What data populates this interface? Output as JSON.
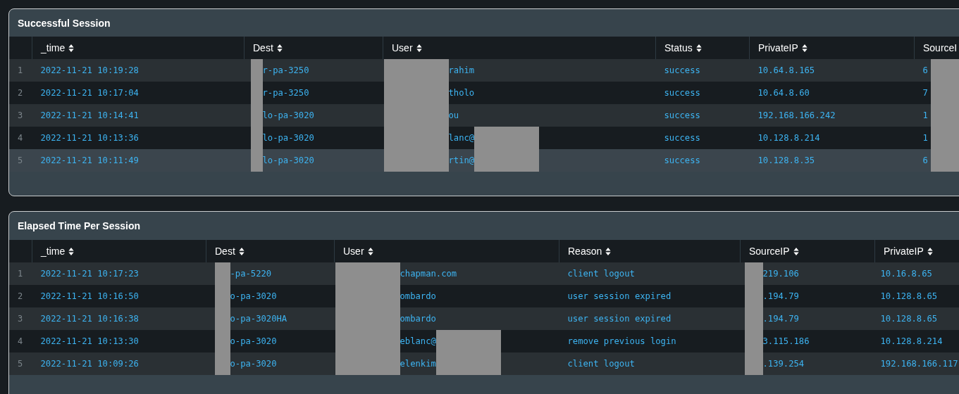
{
  "panels": [
    {
      "title": "Successful Session",
      "columns": [
        {
          "label": "_time"
        },
        {
          "label": "Dest"
        },
        {
          "label": "User"
        },
        {
          "label": "Status"
        },
        {
          "label": "PrivateIP"
        },
        {
          "label": "SourceI"
        }
      ],
      "rows": [
        {
          "number": "1",
          "hovered": false,
          "cells": [
            {
              "text": "2022-11-21 10:19:28"
            },
            {
              "text": "r-pa-3250",
              "redacted_start": true
            },
            {
              "text": "rahim",
              "redacted_start": true
            },
            {
              "text": "success"
            },
            {
              "text": "10.64.8.165"
            },
            {
              "text": "6",
              "redacted_end": true
            }
          ]
        },
        {
          "number": "2",
          "hovered": false,
          "cells": [
            {
              "text": "2022-11-21 10:17:04"
            },
            {
              "text": "r-pa-3250",
              "redacted_start": true
            },
            {
              "text": "tholo",
              "redacted_start": true
            },
            {
              "text": "success"
            },
            {
              "text": "10.64.8.60"
            },
            {
              "text": "7",
              "redacted_end": true
            }
          ]
        },
        {
          "number": "3",
          "hovered": false,
          "cells": [
            {
              "text": "2022-11-21 10:14:41"
            },
            {
              "text": "lo-pa-3020",
              "redacted_start": true
            },
            {
              "text": "ou",
              "redacted_start": true
            },
            {
              "text": "success"
            },
            {
              "text": "192.168.166.242"
            },
            {
              "text": "1",
              "redacted_end": true
            }
          ]
        },
        {
          "number": "4",
          "hovered": false,
          "cells": [
            {
              "text": "2022-11-21 10:13:36"
            },
            {
              "text": "lo-pa-3020",
              "redacted_start": true
            },
            {
              "text": "lanc@",
              "redacted_start": true,
              "redacted_end": true
            },
            {
              "text": "success"
            },
            {
              "text": "10.128.8.214"
            },
            {
              "text": "1",
              "redacted_end": true
            }
          ]
        },
        {
          "number": "5",
          "hovered": true,
          "cells": [
            {
              "text": "2022-11-21 10:11:49"
            },
            {
              "text": "lo-pa-3020",
              "redacted_start": true
            },
            {
              "text": "rtin@",
              "redacted_start": true,
              "redacted_end": true
            },
            {
              "text": "success"
            },
            {
              "text": "10.128.8.35"
            },
            {
              "text": "6",
              "redacted_end": true
            }
          ]
        }
      ]
    },
    {
      "title": "Elapsed Time Per Session",
      "columns": [
        {
          "label": "_time"
        },
        {
          "label": "Dest"
        },
        {
          "label": "User"
        },
        {
          "label": "Reason"
        },
        {
          "label": "SourceIP"
        },
        {
          "label": "PrivateIP"
        }
      ],
      "rows": [
        {
          "number": "1",
          "hovered": false,
          "cells": [
            {
              "text": "2022-11-21 10:17:23"
            },
            {
              "text": "-pa-5220",
              "redacted_start": true
            },
            {
              "text": "chapman.com",
              "redacted_start": true
            },
            {
              "text": "client logout"
            },
            {
              "text": "219.106",
              "redacted_start": true
            },
            {
              "text": "10.16.8.65"
            }
          ]
        },
        {
          "number": "2",
          "hovered": false,
          "cells": [
            {
              "text": "2022-11-21 10:16:50"
            },
            {
              "text": "o-pa-3020",
              "redacted_start": true
            },
            {
              "text": "ombardo",
              "redacted_start": true
            },
            {
              "text": "user session expired"
            },
            {
              "text": ".194.79",
              "redacted_start": true
            },
            {
              "text": "10.128.8.65"
            }
          ]
        },
        {
          "number": "3",
          "hovered": false,
          "cells": [
            {
              "text": "2022-11-21 10:16:38"
            },
            {
              "text": "o-pa-3020HA",
              "redacted_start": true
            },
            {
              "text": "ombardo",
              "redacted_start": true
            },
            {
              "text": "user session expired"
            },
            {
              "text": ".194.79",
              "redacted_start": true
            },
            {
              "text": "10.128.8.65"
            }
          ]
        },
        {
          "number": "4",
          "hovered": false,
          "cells": [
            {
              "text": "2022-11-21 10:13:30"
            },
            {
              "text": "o-pa-3020",
              "redacted_start": true
            },
            {
              "text": "eblanc@",
              "redacted_start": true,
              "redacted_end": true
            },
            {
              "text": "remove previous login"
            },
            {
              "text": "3.115.186",
              "redacted_start": true
            },
            {
              "text": "10.128.8.214"
            }
          ]
        },
        {
          "number": "5",
          "hovered": false,
          "cells": [
            {
              "text": "2022-11-21 10:09:26"
            },
            {
              "text": "o-pa-3020",
              "redacted_start": true
            },
            {
              "text": "elenkim",
              "redacted_start": true,
              "redacted_end": true
            },
            {
              "text": "client logout"
            },
            {
              "text": ".139.254",
              "redacted_start": true
            },
            {
              "text": "192.168.166.117"
            }
          ]
        }
      ]
    }
  ]
}
